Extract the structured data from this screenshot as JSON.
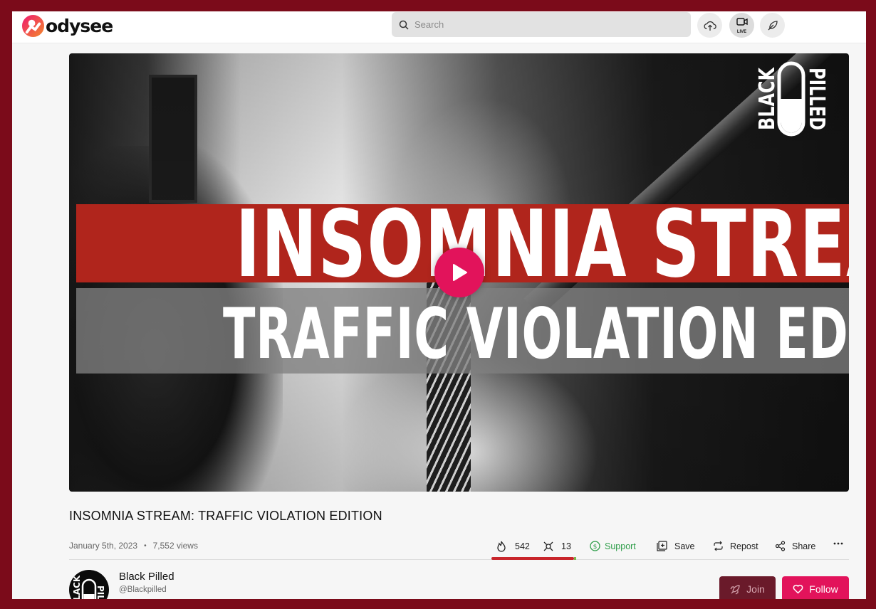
{
  "header": {
    "logo_text": "odysee",
    "search_placeholder": "Search",
    "live_label": "LIVE"
  },
  "player": {
    "thumbnail_line1": "INSOMNIA STREAM",
    "thumbnail_line2": "TRAFFIC VIOLATION EDITION",
    "badge_left": "BLACK",
    "badge_right": "PILLED"
  },
  "video": {
    "title": "INSOMNIA STREAM: TRAFFIC VIOLATION EDITION",
    "date": "January 5th, 2023",
    "views": "7,552 views"
  },
  "actions": {
    "fire_count": "542",
    "slime_count": "13",
    "support_label": "Support",
    "save_label": "Save",
    "repost_label": "Repost",
    "share_label": "Share",
    "reaction_ratio": 0.977
  },
  "channel": {
    "name": "Black Pilled",
    "handle": "@Blackpilled",
    "join_label": "Join",
    "follow_label": "Follow"
  },
  "colors": {
    "brand": "#e2135b",
    "frame": "#7b0b1a",
    "support": "#2f9e4a",
    "fire_bar": "#c8252b"
  }
}
